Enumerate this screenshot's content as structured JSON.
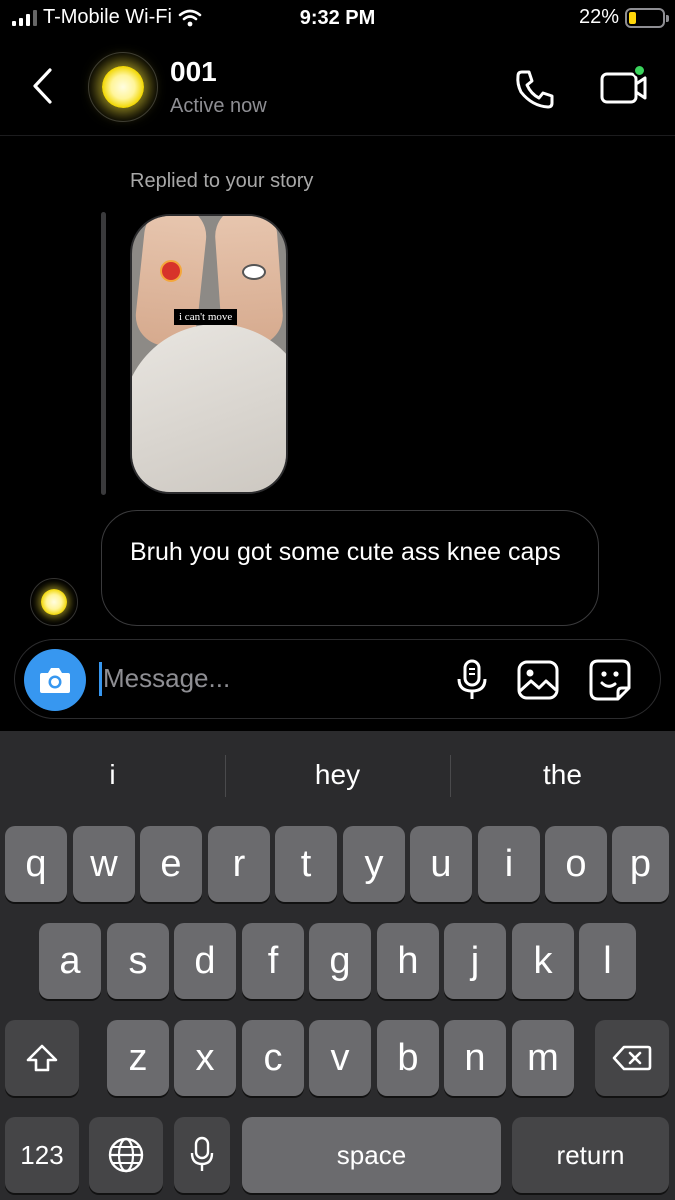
{
  "status_bar": {
    "carrier": "T-Mobile Wi-Fi",
    "time": "9:32 PM",
    "battery_percent": "22%",
    "battery_level": 0.22
  },
  "header": {
    "contact_name": "001",
    "contact_status": "Active now"
  },
  "thread": {
    "reply_label": "Replied to your story",
    "story_caption": "i can't move",
    "message_text": "Bruh you got some cute ass knee caps"
  },
  "composer": {
    "placeholder": "Message..."
  },
  "keyboard": {
    "suggestions": [
      "i",
      "hey",
      "the"
    ],
    "row1": [
      "q",
      "w",
      "e",
      "r",
      "t",
      "y",
      "u",
      "i",
      "o",
      "p"
    ],
    "row2": [
      "a",
      "s",
      "d",
      "f",
      "g",
      "h",
      "j",
      "k",
      "l"
    ],
    "row3": [
      "z",
      "x",
      "c",
      "v",
      "b",
      "n",
      "m"
    ],
    "numbers_label": "123",
    "space_label": "space",
    "return_label": "return"
  },
  "colors": {
    "accent": "#3797f0",
    "active_dot": "#3ad35c",
    "battery": "#ffd60a"
  }
}
